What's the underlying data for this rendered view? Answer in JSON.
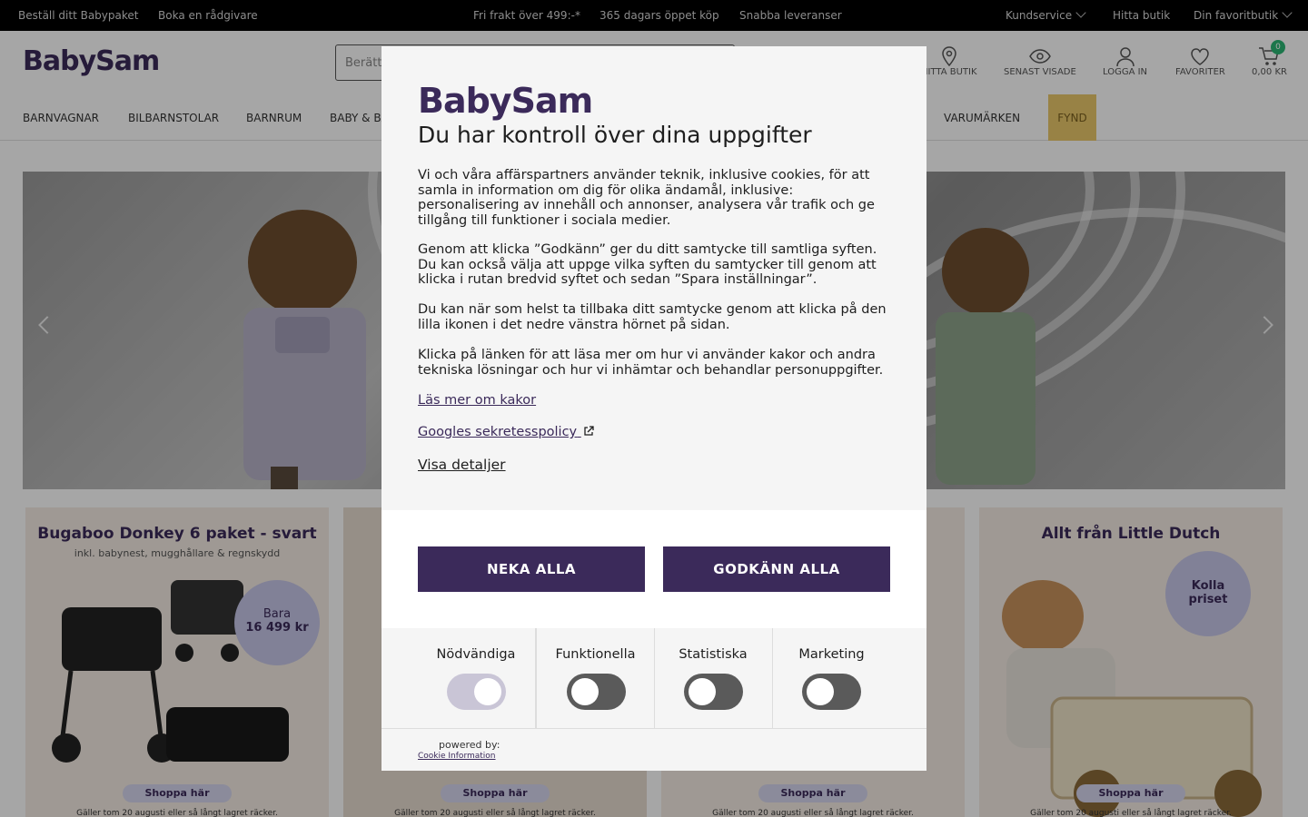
{
  "topbar": {
    "left": [
      "Beställ ditt Babypaket",
      "Boka en rådgivare"
    ],
    "center": [
      "Fri frakt över 499:-*",
      "365 dagars öppet köp",
      "Snabba leveranser"
    ],
    "right": [
      "Kundservice",
      "Hitta butik",
      "Din favoritbutik"
    ]
  },
  "header": {
    "logo": "BabySam",
    "search_placeholder": "Berätt",
    "icons": [
      {
        "label": "HITTA BUTIK",
        "icon": "location-pin-icon"
      },
      {
        "label": "SENAST VISADE",
        "icon": "eye-icon"
      },
      {
        "label": "LOGGA IN",
        "icon": "user-icon"
      },
      {
        "label": "FAVORITER",
        "icon": "heart-icon"
      },
      {
        "label": "0,00 KR",
        "icon": "cart-icon"
      }
    ],
    "cart_count": "0"
  },
  "nav": {
    "items": [
      "BARNVAGNAR",
      "BILBARNSTOLAR",
      "BARNRUM",
      "BABY & BA",
      "VARUMÄRKEN",
      "FYND"
    ]
  },
  "cards": [
    {
      "title": "Bugaboo Donkey 6 paket - svart",
      "subtitle": "inkl. babynest, mugghållare & regnskydd",
      "badge_line1": "Bara",
      "badge_line2": "16 499 kr",
      "cta": "Shoppa här",
      "note": "Gäller tom 20 augusti eller så långt lagret räcker."
    },
    {
      "title": "",
      "subtitle": "",
      "cta": "Shoppa här",
      "note": "Gäller tom 20 augusti eller så långt lagret räcker."
    },
    {
      "title": "",
      "subtitle": "",
      "cta": "Shoppa här",
      "note": "Gäller tom 20 augusti eller så långt lagret räcker."
    },
    {
      "title": "Allt från Little Dutch",
      "subtitle": "",
      "badge_line1": "Kolla",
      "badge_line2": "priset",
      "cta": "Shoppa här",
      "note": "Gäller tom 20 augusti eller så långt lagret räcker."
    }
  ],
  "consent": {
    "logo": "BabySam",
    "title": "Du har kontroll över dina uppgifter",
    "paragraphs": [
      "Vi och våra affärspartners använder teknik, inklusive cookies, för att samla in information om dig för olika ändamål, inklusive: personalisering av innehåll och annonser, analysera vår trafik och ge tillgång till funktioner i sociala medier.",
      "Genom att klicka ”Godkänn” ger du ditt samtycke till samtliga syften. Du kan också välja att uppge vilka syften du samtycker till genom att klicka i rutan bredvid syftet och sedan ”Spara inställningar”.",
      "Du kan när som helst ta tillbaka ditt samtycke genom att klicka på den lilla ikonen i det nedre vänstra hörnet på sidan.",
      "Klicka på länken för att läsa mer om hur vi använder kakor och andra tekniska lösningar och hur vi inhämtar och behandlar personuppgifter."
    ],
    "link_cookies": "Läs mer om kakor",
    "link_google": "Googles sekretesspolicy",
    "details": "Visa detaljer",
    "deny_label": "NEKA ALLA",
    "accept_label": "GODKÄNN ALLA",
    "toggles": [
      {
        "label": "Nödvändiga",
        "on": true
      },
      {
        "label": "Funktionella",
        "on": false
      },
      {
        "label": "Statistiska",
        "on": false
      },
      {
        "label": "Marketing",
        "on": false
      }
    ],
    "powered_by": "powered by:",
    "provider": "Cookie Information"
  },
  "colors": {
    "brand": "#3b2a5a",
    "fynd": "#eac86a",
    "badge": "#2bb673"
  }
}
